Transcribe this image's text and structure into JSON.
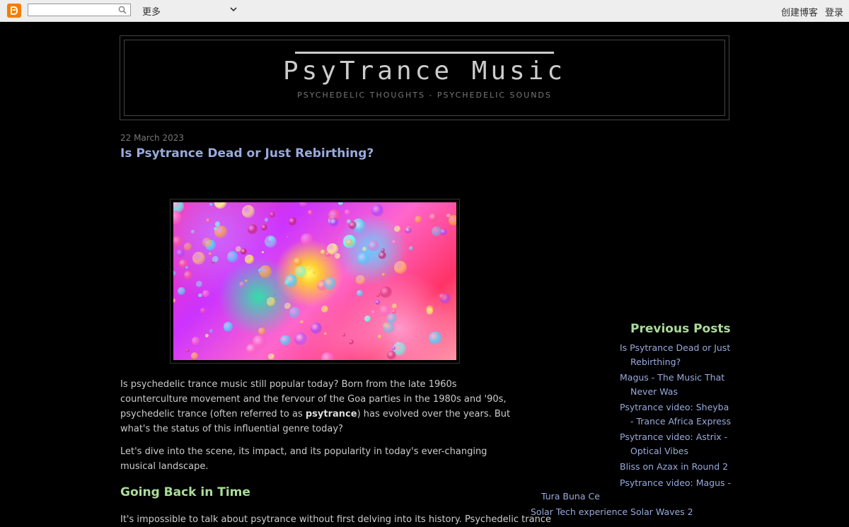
{
  "navbar": {
    "search_value": "",
    "more_label": "更多",
    "create_blog_label": "创建博客",
    "login_label": "登录"
  },
  "header": {
    "title": "PsyTrance Music",
    "description": "PSYCHEDELIC THOUGHTS - PSYCHEDELIC SOUNDS"
  },
  "post": {
    "date": "22 March 2023",
    "title": "Is Psytrance Dead or Just Rebirthing?",
    "paragraph1_before": "Is psychedelic trance music still popular today? Born from the late 1960s counterculture movement and the fervour of the Goa parties in the 1980s and '90s, psychedelic trance (often referred to as ",
    "paragraph1_bold": "psytrance",
    "paragraph1_after": ") has evolved over the years. But what's the status of this influential genre today?",
    "paragraph2": "Let's dive into the scene, its impact, and its popularity in today's ever-changing musical landscape.",
    "section_heading": "Going Back in Time",
    "paragraph3": "It's impossible to talk about psytrance without first delving into its history. Psychedelic trance"
  },
  "sidebar": {
    "heading": "Previous Posts",
    "items": [
      "Is Psytrance Dead or Just Rebirthing?",
      "Magus - The Music That Never Was",
      "Psytrance video: Sheyba - Trance Africa Express",
      "Psytrance video: Astrix - Optical Vibes",
      "Bliss on Azax in Round 2",
      "Psytrance video: Magus -"
    ],
    "stray_1": "Tura Buna Ce",
    "stray_2": "Solar Tech experience Solar Waves 2"
  },
  "colors": {
    "background": "#000000",
    "text": "#cccccc",
    "link": "#99aadd",
    "heading_green": "#aadd99",
    "blogger_orange": "#f57d00"
  }
}
